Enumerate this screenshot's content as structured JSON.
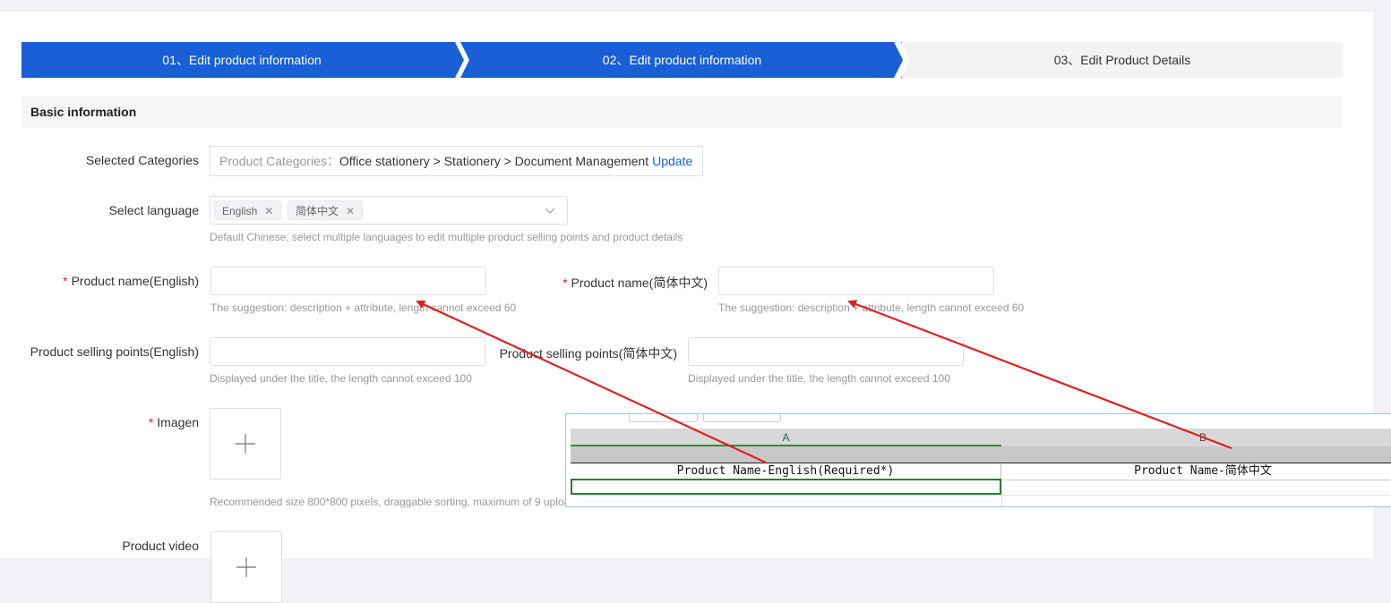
{
  "steps": [
    {
      "label": "01、Edit product information"
    },
    {
      "label": "02、Edit product information"
    },
    {
      "label": "03、Edit Product Details"
    }
  ],
  "section": {
    "title": "Basic information"
  },
  "categories": {
    "label": "Selected Categories",
    "prefix": "Product Categories：",
    "path": "Office stationery > Stationery > Document Management",
    "update": "Update"
  },
  "language": {
    "label": "Select language",
    "tags": [
      "English",
      "简体中文"
    ],
    "hint": "Default Chinese, select multiple languages to edit multiple product selling points and product details"
  },
  "product_name": {
    "en_label": "Product name(English)",
    "zh_label": "Product name(简体中文)",
    "en_value": "",
    "zh_value": "",
    "en_hint": "The suggestion: description + attribute, length cannot exceed 60",
    "zh_hint": "The suggestion: description + attribute, length cannot exceed 60"
  },
  "selling_points": {
    "en_label": "Product selling points(English)",
    "zh_label": "Product selling points(简体中文)",
    "en_value": "",
    "zh_value": "",
    "en_hint": "Displayed under the title, the length cannot exceed 100",
    "zh_hint": "Displayed under the title, the length cannot exceed 100"
  },
  "image": {
    "label": "Imagen",
    "hint": "Recommended size 800*800 pixels, draggable sorting, maximum of 9 uploa"
  },
  "video": {
    "label": "Product video"
  },
  "required_mark": "*",
  "spreadsheet": {
    "columns": [
      "A",
      "B"
    ],
    "row1": [
      "Product Name-English(Required*)",
      "Product Name-简体中文"
    ]
  },
  "colors": {
    "primary": "#1a5fd6",
    "required": "#e02020",
    "annotation_arrow": "#e02020",
    "selected_cell": "#2e7d32"
  },
  "icons": {
    "remove_tag": "close-icon",
    "dropdown": "chevron-down-icon",
    "upload": "plus-icon"
  }
}
